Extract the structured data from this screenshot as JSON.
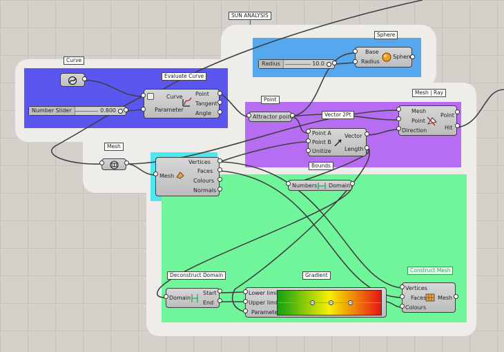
{
  "canvas": {
    "title": "SUN ANALYSIS",
    "colors": {
      "background": "#d4d1cb",
      "group_blue": "#55a7ee",
      "group_indigo": "#5b56f0",
      "group_purple": "#b66df1",
      "group_cyan": "#4ee6ef",
      "group_green": "#70f59b",
      "wire": "#3f3f3f"
    }
  },
  "groups": {
    "sphere": "Sphere",
    "curve": "Curve",
    "evaluate_curve": "Evaluate Curve",
    "point": "Point",
    "mesh_ray": "Mesh | Ray",
    "vector2pt": "Vector 2Pt",
    "mesh": "Mesh",
    "bounds": "Bounds",
    "deconstruct_domain": "Deconstruct Domain",
    "gradient": "Gradient",
    "construct_mesh": "Construct Mesh"
  },
  "sliders": {
    "radius": {
      "label": "Radius",
      "value": "10.0"
    },
    "number": {
      "label": "Number Slider",
      "value": "0.800"
    }
  },
  "components": {
    "sphere": {
      "inputs": [
        "Base",
        "Radius"
      ],
      "outputs": [
        "Sphere"
      ]
    },
    "evaluate": {
      "inputs": [
        "Curve",
        "Parameter"
      ],
      "outputs": [
        "Point",
        "Tangent",
        "Angle"
      ]
    },
    "point": {
      "label": "Attractor point"
    },
    "meshray": {
      "inputs": [
        "Mesh",
        "Point",
        "Direction"
      ],
      "outputs": [
        "Point",
        "Hit"
      ]
    },
    "vector": {
      "inputs": [
        "Point A",
        "Point B",
        "Unitize"
      ],
      "outputs": [
        "Vector",
        "Length"
      ]
    },
    "deconmesh": {
      "inputs": [
        "Mesh"
      ],
      "outputs": [
        "Vertices",
        "Faces",
        "Colours",
        "Normals"
      ]
    },
    "bounds": {
      "inputs": [
        "Numbers"
      ],
      "outputs": [
        "Domain"
      ]
    },
    "decondomain": {
      "inputs": [
        "Domain"
      ],
      "outputs": [
        "Start",
        "End"
      ]
    },
    "gradient": {
      "inputs": [
        "Lower limit",
        "Upper limit",
        "Parameter"
      ]
    },
    "constructmesh": {
      "inputs": [
        "Vertices",
        "Faces",
        "Colours"
      ],
      "outputs": [
        "Mesh"
      ]
    }
  },
  "gradient_stops": {
    "colors": [
      "#14a014",
      "#f5f000",
      "#e61414"
    ],
    "markers": [
      0.33,
      0.51,
      0.7
    ]
  },
  "icons": [
    "curve-param-icon",
    "sphere-icon",
    "mesh-ray-icon",
    "vector-icon",
    "deconstruct-mesh-icon",
    "bounds-icon",
    "domain-icon",
    "construct-mesh-icon"
  ]
}
